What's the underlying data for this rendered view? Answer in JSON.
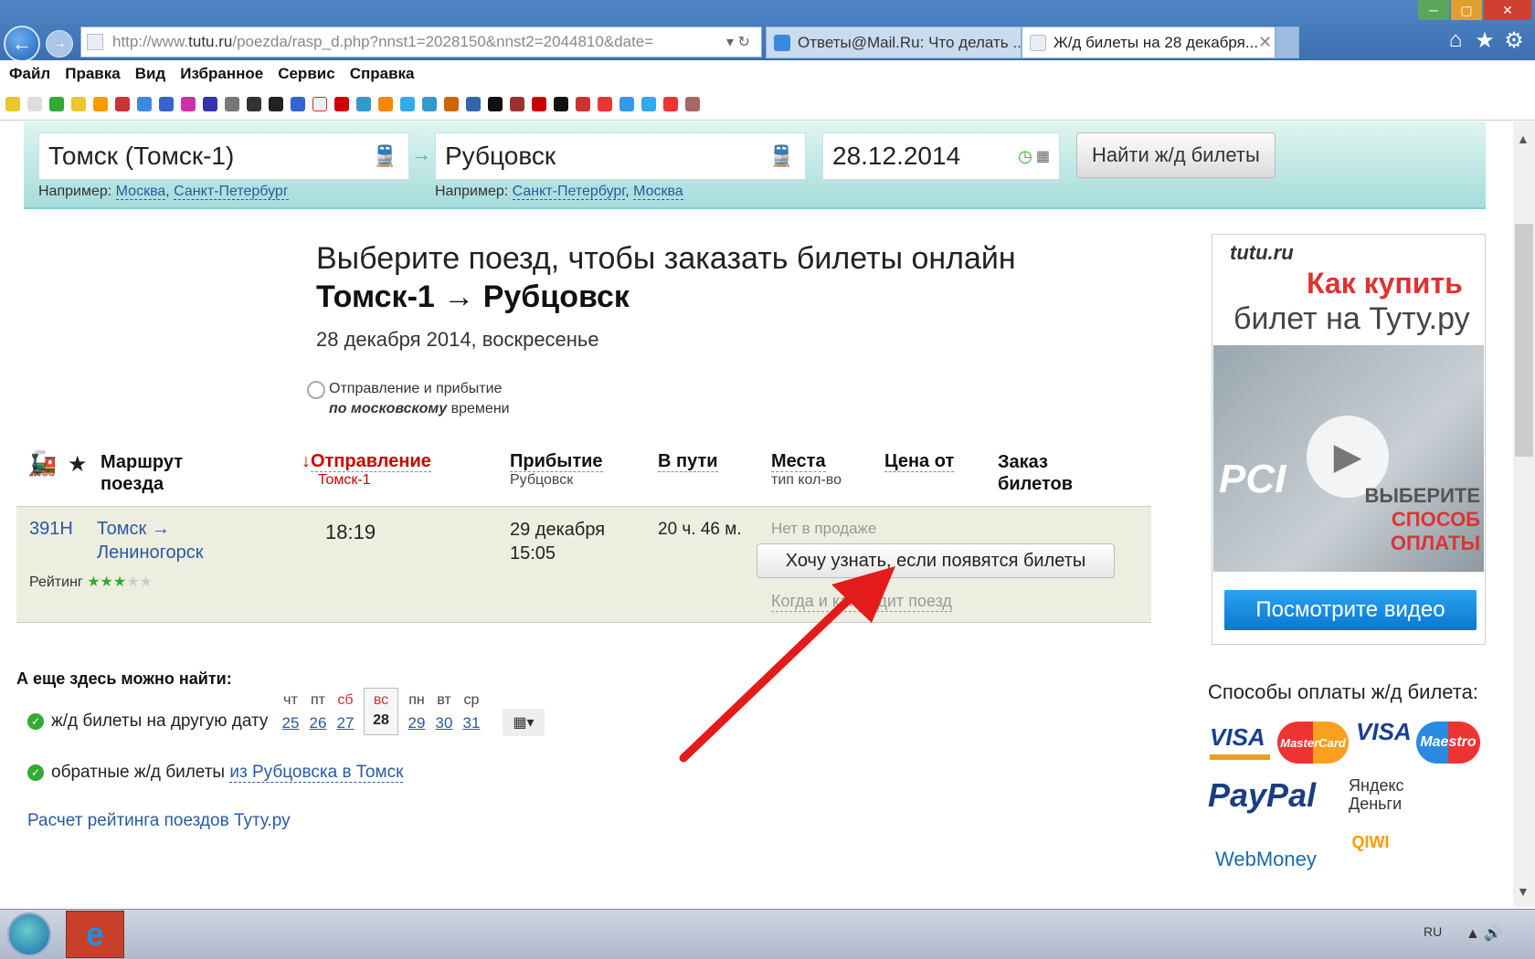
{
  "browser": {
    "url_prefix": "http://www.",
    "url_domain": "tutu.ru",
    "url_path": "/poezda/rasp_d.php?nnst1=2028150&nnst2=2044810&date=",
    "tabs": [
      {
        "title": "Ответы@Mail.Ru: Что делать ..."
      },
      {
        "title": "Ж/д билеты на 28 декабря..."
      }
    ],
    "menu": [
      "Файл",
      "Правка",
      "Вид",
      "Избранное",
      "Сервис",
      "Справка"
    ]
  },
  "search": {
    "from": "Томск (Томск-1)",
    "to": "Рубцовск",
    "date": "28.12.2014",
    "hint_label": "Например:",
    "from_hints": [
      "Москва",
      "Санкт-Петербург"
    ],
    "to_hints": [
      "Санкт-Петербург",
      "Москва"
    ],
    "find_button": "Найти ж/д билеты"
  },
  "heading": {
    "line1": "Выберите поезд, чтобы заказать билеты онлайн",
    "route": "Томск-1 → Рубцовск",
    "date": "28 декабря 2014, воскресенье",
    "tz_line1": "Отправление и прибытие",
    "tz_bold": "по московскому",
    "tz_rest": " времени"
  },
  "table": {
    "col_route": "Маршрут поезда",
    "col_departure": "Отправление",
    "col_departure_sub": "Томск-1",
    "col_arrival": "Прибытие",
    "col_arrival_sub": "Рубцовск",
    "col_duration": "В пути",
    "col_seats": "Места",
    "col_seats_sub": "тип кол-во",
    "col_price": "Цена от",
    "col_order": "Заказ билетов",
    "row": {
      "train": "391Н",
      "route_from": "Томск →",
      "route_to": "Лениногорск",
      "rating_label": "Рейтинг",
      "rating_value": "3/5",
      "departure": "18:19",
      "arrival_date": "29 декабря",
      "arrival_time": "15:05",
      "duration": "20 ч. 46 м.",
      "availability": "Нет в продаже",
      "notify_button": "Хочу узнать, если появятся билеты",
      "schedule_link": "Когда и как ходит поезд"
    }
  },
  "more": {
    "title": "А еще здесь можно найти:",
    "other_date": "ж/д билеты на другую дату",
    "days": [
      {
        "wd": "чт",
        "d": "25"
      },
      {
        "wd": "пт",
        "d": "26"
      },
      {
        "wd": "сб",
        "d": "27"
      },
      {
        "wd": "вс",
        "d": "28"
      },
      {
        "wd": "пн",
        "d": "29"
      },
      {
        "wd": "вт",
        "d": "30"
      },
      {
        "wd": "ср",
        "d": "31"
      }
    ],
    "back_label": "обратные ж/д билеты",
    "back_link": "из Рубцовска в Томск",
    "rating_calc": "Расчет рейтинга поездов Туту.ру"
  },
  "ad": {
    "logo": "tutu.ru",
    "title1": "Как купить",
    "title2": "билет на Туту.ру",
    "pci": "PCI",
    "choose1": "ВЫБЕРИТЕ",
    "choose2": "СПОСОБ ОПЛАТЫ",
    "video_button": "Посмотрите видео"
  },
  "payments": {
    "title": "Способы оплаты ж/д билета:",
    "logos": [
      "VISA",
      "MasterCard",
      "VISA",
      "Maestro",
      "PayPal",
      "Яндекс Деньги",
      "WebMoney",
      "QIWI"
    ]
  },
  "taskbar": {
    "lang": "RU"
  },
  "colors": {
    "accent_red": "#c00",
    "link": "#2a5aa0",
    "band": "#a6dcdc"
  }
}
